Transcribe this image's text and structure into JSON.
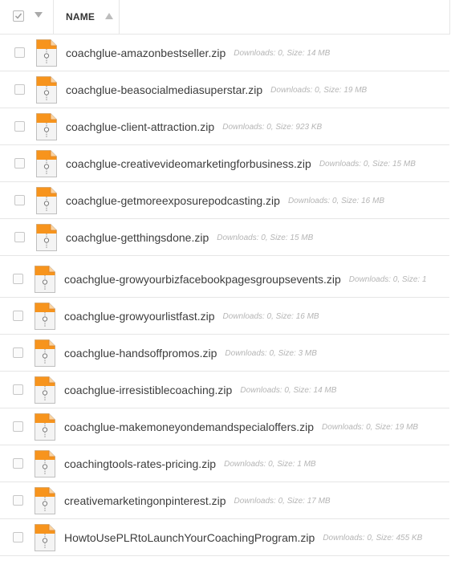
{
  "header": {
    "select_all_checked": true,
    "column_name": "NAME",
    "sort_direction": "ascending"
  },
  "files": [
    {
      "name": "coachglue-amazonbestseller.zip",
      "meta": "Downloads: 0, Size: 14 MB"
    },
    {
      "name": "coachglue-beasocialmediasuperstar.zip",
      "meta": "Downloads: 0, Size: 19 MB"
    },
    {
      "name": "coachglue-client-attraction.zip",
      "meta": "Downloads: 0, Size: 923 KB"
    },
    {
      "name": "coachglue-creativevideomarketingforbusiness.zip",
      "meta": "Downloads: 0, Size: 15 MB"
    },
    {
      "name": "coachglue-getmoreexposurepodcasting.zip",
      "meta": "Downloads: 0, Size: 16 MB"
    },
    {
      "name": "coachglue-getthingsdone.zip",
      "meta": "Downloads: 0, Size: 15 MB"
    },
    {
      "name": "coachglue-growyourbizfacebookpagesgroupsevents.zip",
      "meta": "Downloads: 0, Size: 1"
    },
    {
      "name": "coachglue-growyourlistfast.zip",
      "meta": "Downloads: 0, Size: 16 MB"
    },
    {
      "name": "coachglue-handsoffpromos.zip",
      "meta": "Downloads: 0, Size: 3 MB"
    },
    {
      "name": "coachglue-irresistiblecoaching.zip",
      "meta": "Downloads: 0, Size: 14 MB"
    },
    {
      "name": "coachglue-makemoneyondemandspecialoffers.zip",
      "meta": "Downloads: 0, Size: 19 MB"
    },
    {
      "name": "coachingtools-rates-pricing.zip",
      "meta": "Downloads: 0, Size: 1 MB"
    },
    {
      "name": "creativemarketingonpinterest.zip",
      "meta": "Downloads: 0, Size: 17 MB"
    },
    {
      "name": "HowtoUsePLRtoLaunchYourCoachingProgram.zip",
      "meta": "Downloads: 0, Size: 455 KB"
    }
  ],
  "icons": {
    "file": "zip-file-icon",
    "accent": "#f7941d"
  }
}
